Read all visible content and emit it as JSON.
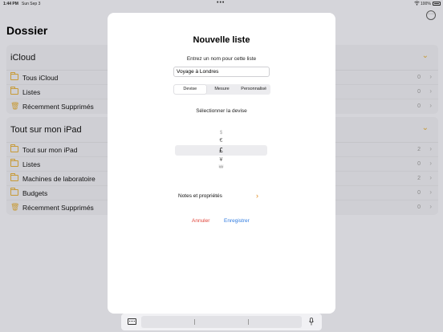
{
  "status": {
    "time": "1:44 PM",
    "date": "Sun Sep 3",
    "battery": "100%"
  },
  "page": {
    "title": "Dossier"
  },
  "sections": [
    {
      "title": "iCloud",
      "items": [
        {
          "label": "Tous iCloud",
          "count": "0",
          "icon": "folder-icon"
        },
        {
          "label": "Listes",
          "count": "0",
          "icon": "folder-icon"
        },
        {
          "label": "Récemment Supprimés",
          "count": "0",
          "icon": "trash-icon"
        }
      ]
    },
    {
      "title": "Tout sur mon iPad",
      "items": [
        {
          "label": "Tout sur mon iPad",
          "count": "2",
          "icon": "folder-icon"
        },
        {
          "label": "Listes",
          "count": "0",
          "icon": "folder-icon"
        },
        {
          "label": "Machines de laboratoire",
          "count": "2",
          "icon": "folder-icon"
        },
        {
          "label": "Budgets",
          "count": "0",
          "icon": "folder-icon"
        },
        {
          "label": "Récemment Supprimés",
          "count": "0",
          "icon": "trash-icon"
        }
      ]
    }
  ],
  "modal": {
    "title": "Nouvelle liste",
    "prompt": "Entrez un nom pour cette liste",
    "name_value": "Voyage à Londres",
    "tabs": [
      "Devise",
      "Mesure",
      "Personnalisé"
    ],
    "active_tab": "Devise",
    "select_label": "Sélectionner la devise",
    "currencies": [
      "$",
      "€",
      "£",
      "¥",
      "₩"
    ],
    "selected_currency": "£",
    "notes_label": "Notes et propriétés",
    "cancel_label": "Annuler",
    "save_label": "Enregistrer"
  },
  "colors": {
    "accent": "#c79a35",
    "cancel": "#e0443a",
    "save": "#2f7be0",
    "chevron": "#e08a1e"
  }
}
